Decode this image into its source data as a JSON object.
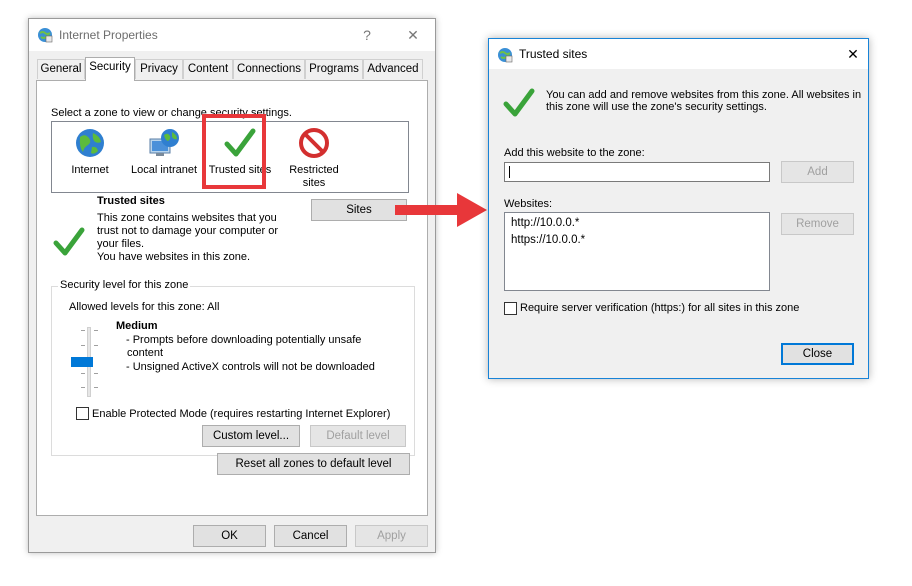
{
  "internet_properties": {
    "title": "Internet Properties",
    "help_symbol": "?",
    "close_symbol": "✕",
    "tabs": [
      {
        "label": "General"
      },
      {
        "label": "Security"
      },
      {
        "label": "Privacy"
      },
      {
        "label": "Content"
      },
      {
        "label": "Connections"
      },
      {
        "label": "Programs"
      },
      {
        "label": "Advanced"
      }
    ],
    "active_tab": "Security",
    "zone_prompt": "Select a zone to view or change security settings.",
    "zones": [
      {
        "label": "Internet",
        "icon": "globe-icon"
      },
      {
        "label": "Local intranet",
        "icon": "network-globe-icon"
      },
      {
        "label": "Trusted sites",
        "icon": "green-checkmark-icon"
      },
      {
        "label": "Restricted sites",
        "icon": "restricted-icon"
      }
    ],
    "zone_info": {
      "heading": "Trusted sites",
      "description_lines": [
        "This zone contains websites that you",
        "trust not to damage your computer or",
        "your files.",
        "You have websites in this zone."
      ]
    },
    "sites_button": "Sites",
    "security_level": {
      "group_title": "Security level for this zone",
      "allowed_levels": "Allowed levels for this zone: All",
      "level_name": "Medium",
      "bullets": [
        "- Prompts before downloading potentially unsafe",
        "content",
        "- Unsigned ActiveX controls will not be downloaded"
      ],
      "protected_mode_label": "Enable Protected Mode (requires restarting Internet Explorer)",
      "protected_mode_checked": false,
      "custom_level_button": "Custom level...",
      "default_level_button": "Default level"
    },
    "reset_button": "Reset all zones to default level",
    "ok_button": "OK",
    "cancel_button": "Cancel",
    "apply_button": "Apply"
  },
  "trusted_sites_dialog": {
    "title": "Trusted sites",
    "close_symbol": "✕",
    "info_line1": "You can add and remove websites from this zone. All websites in",
    "info_line2": "this zone will use the zone's security settings.",
    "add_label": "Add this website to the zone:",
    "add_input_value": "",
    "add_button": "Add",
    "websites_label": "Websites:",
    "websites": [
      "http://10.0.0.*",
      "https://10.0.0.*"
    ],
    "remove_button": "Remove",
    "require_verification_label": "Require server verification (https:) for all sites in this zone",
    "require_verification_checked": false,
    "close_button": "Close"
  },
  "colors": {
    "highlight": "#e8373a",
    "arrow": "#e8373a",
    "accent": "#0078d7",
    "check_green": "#3aa33a"
  }
}
